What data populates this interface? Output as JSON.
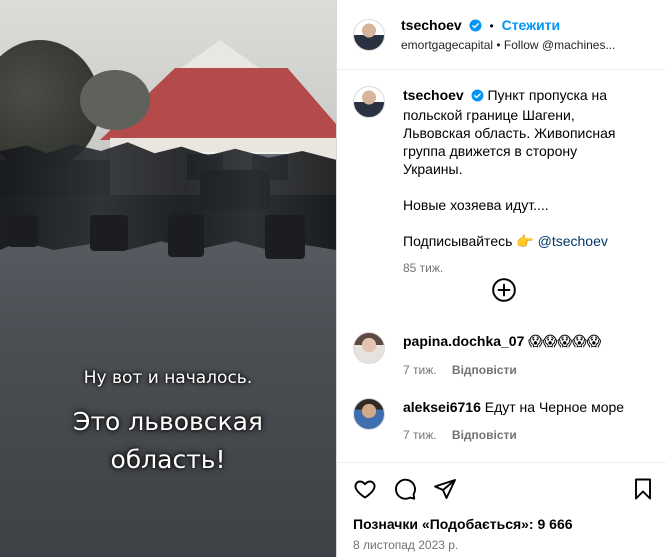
{
  "media": {
    "caption_small": "Ну вот и началось.",
    "caption_big": "Это львовская область!"
  },
  "header": {
    "username": "tsechoev",
    "separator": "•",
    "follow_label": "Стежити",
    "subline": "emortgagecapital • Follow @machines..."
  },
  "caption": {
    "username": "tsechoev",
    "line1": "Пункт пропуска на польской границе Шагени, Львовская область. Живописная группа движется в сторону Украины.",
    "line2": "Новые хозяева идут....",
    "line3_prefix": "Подписывайтесь",
    "line3_emoji": "👉",
    "line3_mention": "@tsechoev",
    "time": "85 тиж."
  },
  "comments": [
    {
      "username": "papina.dochka_07",
      "text": "😱😱😱😱😱",
      "time": "7 тиж.",
      "reply": "Відповісти"
    },
    {
      "username": "aleksei6716",
      "text": "Едут на Черное море",
      "time": "7 тиж.",
      "reply": "Відповісти"
    }
  ],
  "footer": {
    "likes": "Позначки «Подобається»: 9 666",
    "date": "8 листопад 2023 р."
  },
  "icons": {
    "verified": "verified-badge-icon",
    "more": "plus-circle-icon",
    "like": "heart-icon",
    "comment": "comment-bubble-icon",
    "share": "paper-plane-icon",
    "save": "bookmark-icon"
  },
  "colors": {
    "accent": "#0095f6",
    "verified": "#0095f6",
    "muted": "#737373"
  }
}
